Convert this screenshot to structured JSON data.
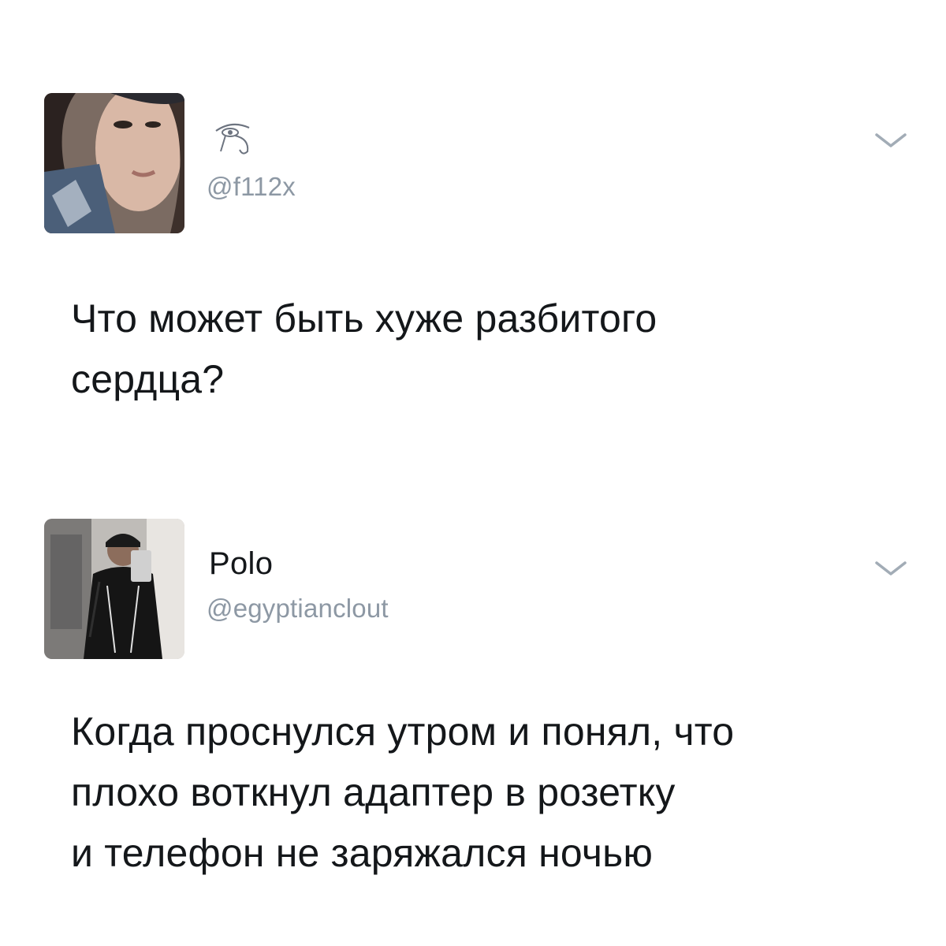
{
  "tweets": [
    {
      "display_name_icon": "eye-of-horus-icon",
      "handle": "@f112x",
      "text": "Что может быть хуже разбитого\nсердца?",
      "menu_icon": "chevron-down-icon"
    },
    {
      "display_name": "Polo",
      "handle": "@egyptianclout",
      "text": "Когда проснулся утром и понял, что\nплохо воткнул адаптер в розетку\nи телефон не заряжался ночью",
      "menu_icon": "chevron-down-icon"
    }
  ],
  "colors": {
    "text_primary": "#14171a",
    "text_secondary": "#8d98a4",
    "chevron": "#a2acb6",
    "background": "#ffffff"
  }
}
